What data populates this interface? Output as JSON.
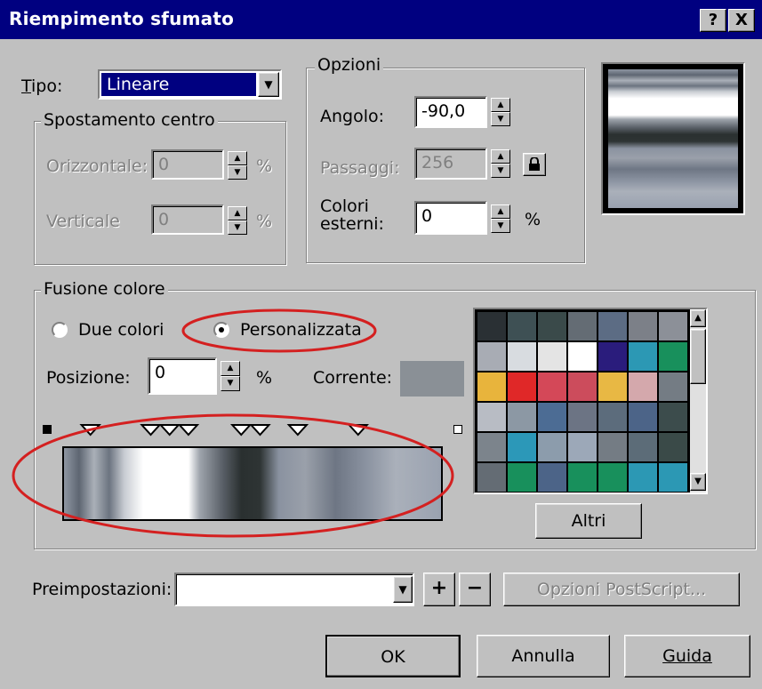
{
  "title": "Riempimento sfumato",
  "titlebar": {
    "help": "?",
    "close": "X"
  },
  "tipo": {
    "label": "Tipo:",
    "value": "Lineare"
  },
  "spostamento": {
    "legend": "Spostamento centro",
    "orizzontale": {
      "label": "Orizzontale:",
      "value": "0",
      "unit": "%"
    },
    "verticale": {
      "label": "Verticale",
      "value": "0",
      "unit": "%"
    }
  },
  "opzioni": {
    "legend": "Opzioni",
    "angolo": {
      "label": "Angolo:",
      "value": "-90,0"
    },
    "passaggi": {
      "label": "Passaggi:",
      "value": "256"
    },
    "colori_esterni": {
      "label1": "Colori",
      "label2": "esterni:",
      "value": "0",
      "unit": "%"
    }
  },
  "fusione": {
    "legend": "Fusione colore",
    "options": [
      "Due colori",
      "Personalizzata"
    ],
    "selected": "Personalizzata",
    "posizione": {
      "label": "Posizione:",
      "value": "0",
      "unit": "%"
    },
    "corrente": {
      "label": "Corrente:",
      "color": "#8a9096"
    },
    "altri": "Altri"
  },
  "gradient_stops": [
    {
      "pos": 0,
      "color": "#8e96a2"
    },
    {
      "pos": 0.04,
      "color": "#5e6672"
    },
    {
      "pos": 0.08,
      "color": "#aab0b8"
    },
    {
      "pos": 0.12,
      "color": "#6c7480"
    },
    {
      "pos": 0.16,
      "color": "#c8ccd2"
    },
    {
      "pos": 0.21,
      "color": "#ffffff"
    },
    {
      "pos": 0.33,
      "color": "#ffffff"
    },
    {
      "pos": 0.36,
      "color": "#9ea4ac"
    },
    {
      "pos": 0.42,
      "color": "#5a6068"
    },
    {
      "pos": 0.47,
      "color": "#2a3030"
    },
    {
      "pos": 0.52,
      "color": "#2e3434"
    },
    {
      "pos": 0.57,
      "color": "#8a92a0"
    },
    {
      "pos": 0.64,
      "color": "#9aa0aa"
    },
    {
      "pos": 0.72,
      "color": "#6e7684"
    },
    {
      "pos": 0.8,
      "color": "#8a92a0"
    },
    {
      "pos": 0.88,
      "color": "#aab0ba"
    },
    {
      "pos": 1,
      "color": "#9aa2b0"
    }
  ],
  "marker_positions": [
    0.07,
    0.23,
    0.28,
    0.33,
    0.47,
    0.52,
    0.62,
    0.78
  ],
  "palette": [
    [
      "#2a3034",
      "#3e5054",
      "#3a4a4a",
      "#646c74",
      "#5c6c84",
      "#7c8088",
      "#8c9098"
    ],
    [
      "#a8acb4",
      "#d8dce0",
      "#e4e4e4",
      "#ffffff",
      "#2a1c7c",
      "#2c98b4",
      "#18905c"
    ],
    [
      "#e8b43c",
      "#e02828",
      "#d44858",
      "#cc4c5c",
      "#e8b844",
      "#d4a8ac",
      "#747c84"
    ],
    [
      "#b8bcc4",
      "#8c98a4",
      "#4c6c94",
      "#6c7484",
      "#5c6c7c",
      "#4c6488",
      "#3c4c4c"
    ],
    [
      "#7c848c",
      "#2c98b8",
      "#8c9cac",
      "#9ca8b8",
      "#747c84",
      "#5c6c78",
      "#3a4a48"
    ],
    [
      "#646c74",
      "#18905c",
      "#4c6488",
      "#18905c",
      "#18905c",
      "#2c98b4",
      "#2c98b4"
    ]
  ],
  "preimpostazioni": {
    "label": "Preimpostazioni:",
    "value": "",
    "add": "+",
    "remove": "−",
    "postscript": "Opzioni PostScript..."
  },
  "buttons": {
    "ok": "OK",
    "annulla": "Annulla",
    "guida": "Guida"
  },
  "colors": {
    "titlebar": "#000080",
    "annotation": "#d42020",
    "face": "#c0c0c0"
  }
}
